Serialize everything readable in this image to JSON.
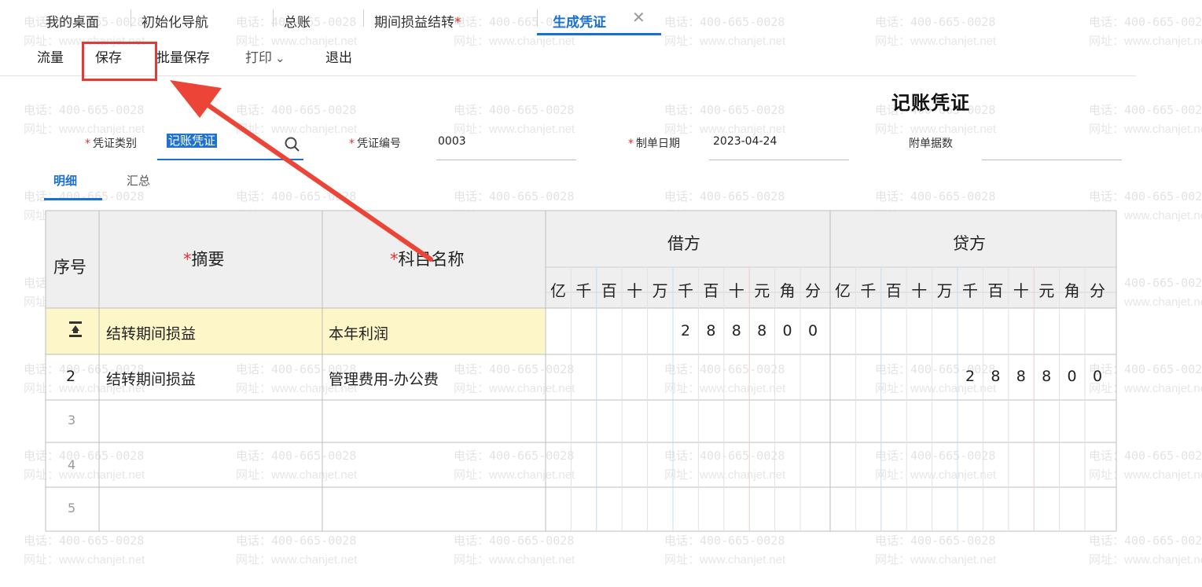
{
  "tabs": [
    {
      "label": "我的桌面",
      "active": false,
      "modified": false
    },
    {
      "label": "初始化导航",
      "active": false,
      "modified": false
    },
    {
      "label": "总账",
      "active": false,
      "modified": false
    },
    {
      "label": "期间损益结转",
      "active": false,
      "modified": true
    },
    {
      "label": "生成凭证",
      "active": true,
      "modified": false
    }
  ],
  "tab_modified_mark": "*",
  "tab_close_glyph": "✕",
  "toolbar": {
    "flow": "流量",
    "save": "保存",
    "batch_save": "批量保存",
    "print": "打印",
    "print_caret": "⌄",
    "exit": "退出"
  },
  "voucher": {
    "title": "记账凭证",
    "required_mark": "*",
    "type_label": "凭证类别",
    "type_value": "记账凭证",
    "number_label": "凭证编号",
    "number_value": "0003",
    "date_label": "制单日期",
    "date_value": "2023-04-24",
    "attachments_label": "附单据数",
    "attachments_value": ""
  },
  "subtabs": {
    "detail": "明细",
    "summary": "汇总"
  },
  "grid": {
    "seq_header": "序号",
    "summary_header": "摘要",
    "account_header": "科目名称",
    "debit_header": "借方",
    "credit_header": "贷方",
    "units": [
      "亿",
      "千",
      "百",
      "十",
      "万",
      "千",
      "百",
      "十",
      "元",
      "角",
      "分"
    ],
    "rows": [
      {
        "seq": "",
        "seq_icon": "row-insert-icon",
        "summary": "结转期间损益",
        "account": "本年利润",
        "debit_digits": [
          "",
          "",
          "",
          "",
          "",
          "2",
          "8",
          "8",
          "8",
          "0",
          "0"
        ],
        "credit_digits": [
          "",
          "",
          "",
          "",
          "",
          "",
          "",
          "",
          "",
          "",
          ""
        ]
      },
      {
        "seq": "2",
        "summary": "结转期间损益",
        "account": "管理费用-办公费",
        "debit_digits": [
          "",
          "",
          "",
          "",
          "",
          "",
          "",
          "",
          "",
          "",
          ""
        ],
        "credit_digits": [
          "",
          "",
          "",
          "",
          "",
          "2",
          "8",
          "8",
          "8",
          "0",
          "0"
        ]
      },
      {
        "seq": "3",
        "summary": "",
        "account": ""
      },
      {
        "seq": "4",
        "summary": "",
        "account": ""
      },
      {
        "seq": "5",
        "summary": "",
        "account": ""
      }
    ]
  },
  "watermark": {
    "phone": "电话：400-665-0028",
    "site": "网址：www.chanjet.net"
  },
  "colors": {
    "accent": "#1a6fd3",
    "highlight_box": "#e53935",
    "row_highlight": "#fdf6c9",
    "required": "#e0312f"
  }
}
